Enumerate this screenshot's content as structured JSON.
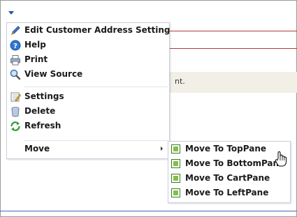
{
  "background": {
    "note_text": "nt."
  },
  "menu": {
    "items": [
      {
        "label": "Edit Customer Address Setting",
        "icon": "pencil-icon"
      },
      {
        "label": "Help",
        "icon": "help-icon"
      },
      {
        "label": "Print",
        "icon": "printer-icon"
      },
      {
        "label": "View Source",
        "icon": "magnifier-icon"
      },
      {
        "label": "Settings",
        "icon": "settings-icon"
      },
      {
        "label": "Delete",
        "icon": "trash-icon"
      },
      {
        "label": "Refresh",
        "icon": "refresh-icon"
      },
      {
        "label": "Move",
        "icon": ""
      }
    ]
  },
  "submenu": {
    "items": [
      {
        "label": "Move To TopPane"
      },
      {
        "label": "Move To BottomPane"
      },
      {
        "label": "Move To CartPane"
      },
      {
        "label": "Move To LeftPane"
      }
    ]
  },
  "colors": {
    "accent_blue": "#1d5aa8",
    "rule_red": "#b53a3a",
    "note_bg": "#f1efe6",
    "pane_green": "#7fbf4a"
  }
}
